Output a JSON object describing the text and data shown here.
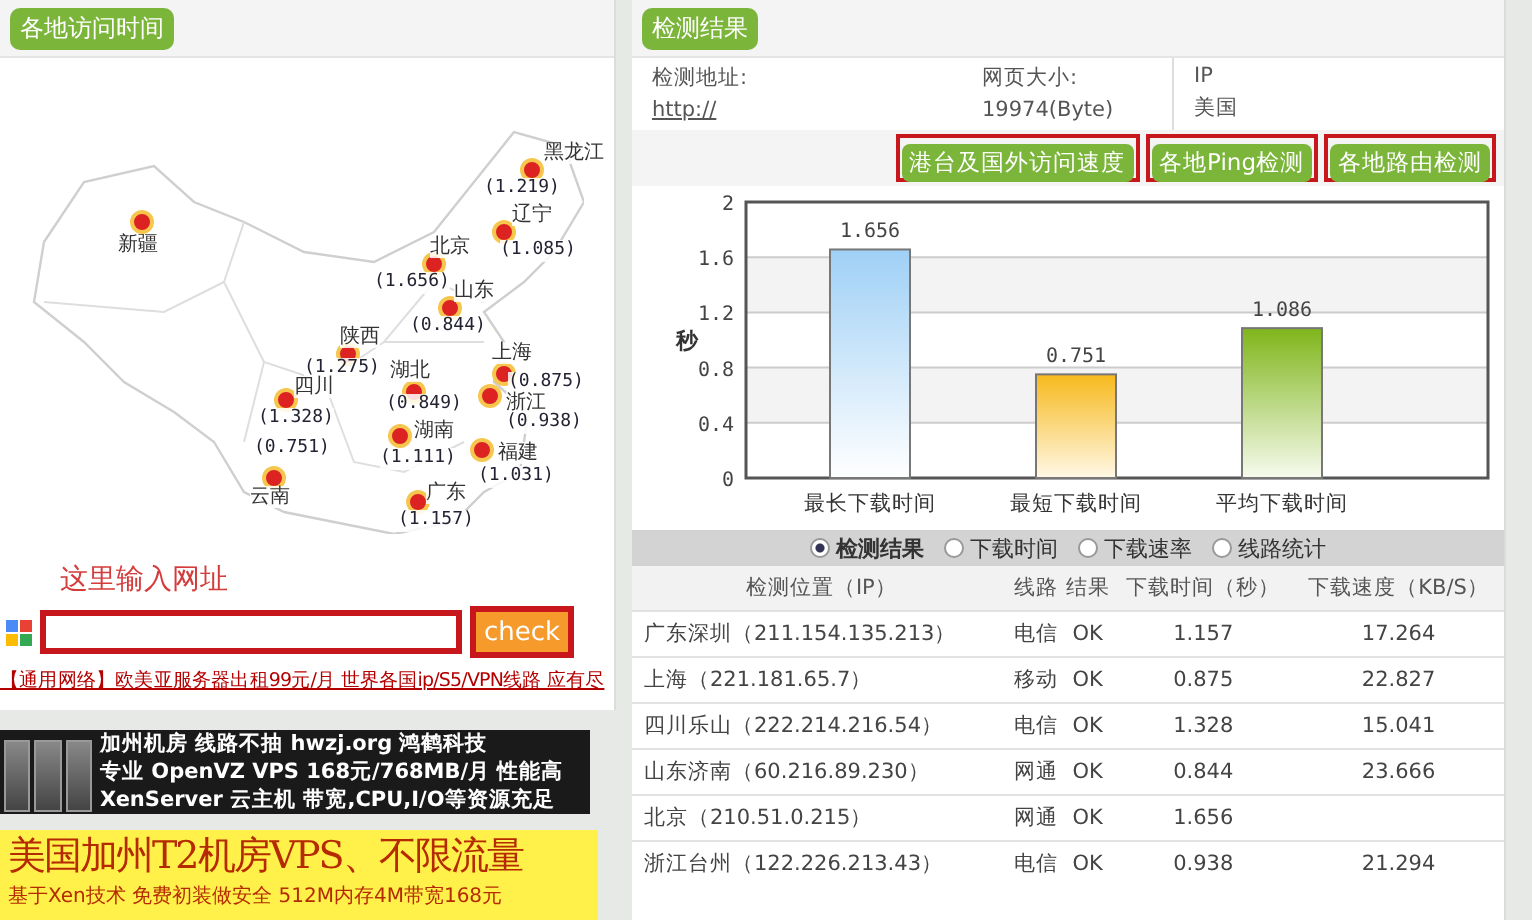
{
  "left_panel": {
    "title": "各地访问时间",
    "map_markers": [
      {
        "region": "黑龙江",
        "value": "(1.219)"
      },
      {
        "region": "新疆"
      },
      {
        "region": "辽宁",
        "value": "(1.085)"
      },
      {
        "region": "北京",
        "value": "(1.656)"
      },
      {
        "region": "山东",
        "value": "(0.844)"
      },
      {
        "region": "陕西",
        "value": "(1.275)"
      },
      {
        "region": "四川",
        "value": "(1.328)"
      },
      {
        "region": "湖北",
        "value": "(0.849)"
      },
      {
        "region": "上海",
        "value": "(0.875)"
      },
      {
        "region": "浙江",
        "value": "(0.938)"
      },
      {
        "region": "云南",
        "value": "(0.751)"
      },
      {
        "region": "湖南",
        "value": "(1.111)"
      },
      {
        "region": "福建",
        "value": "(1.031)"
      },
      {
        "region": "广东",
        "value": "(1.157)"
      }
    ],
    "hint": "这里输入网址",
    "check_button": "check",
    "promo_link": "【通用网络】欧美亚服务器出租99元/月 世界各国ip/S5/VPN线路 应有尽",
    "ads": [
      {
        "kind": "dark",
        "lines": [
          "加州机房 线路不抽  hwzj.org   鸿鹤科技",
          "专业 OpenVZ VPS 168元/768MB/月 性能高",
          "XenServer 云主机 带宽,CPU,I/O等资源充足"
        ]
      },
      {
        "kind": "yellow",
        "lines": [
          "美国加州T2机房VPS、不限流量",
          "基于Xen技术 免费初装做安全 512M内存4M带宽168元"
        ]
      }
    ]
  },
  "right_panel": {
    "title": "检测结果",
    "info": [
      {
        "label": "检测地址:",
        "value": "http://",
        "kind": "link"
      },
      {
        "label": "网页大小:",
        "value": "19974(Byte)",
        "kind": "text"
      },
      {
        "label": "IP",
        "value": "美国",
        "kind": "text"
      }
    ],
    "buttons": [
      "港台及国外访问速度",
      "各地Ping检测",
      "各地路由检测"
    ],
    "chart_data": {
      "type": "bar",
      "ylabel": "秒",
      "categories": [
        "最长下载时间",
        "最短下载时间",
        "平均下载时间"
      ],
      "values": [
        1.656,
        0.751,
        1.086
      ],
      "ylim": [
        0,
        2
      ],
      "yticks": [
        0,
        0.4,
        0.8,
        1.2,
        1.6,
        2
      ],
      "grid": true,
      "data_labels": true
    },
    "view_options": [
      {
        "label": "检测结果",
        "selected": true
      },
      {
        "label": "下载时间",
        "selected": false
      },
      {
        "label": "下载速率",
        "selected": false
      },
      {
        "label": "线路统计",
        "selected": false
      }
    ],
    "table": {
      "columns": [
        "检测位置（IP）",
        "线路",
        "结果",
        "下载时间（秒）",
        "下载速度（KB/S）"
      ],
      "rows": [
        [
          "广东深圳（211.154.135.213）",
          "电信",
          "OK",
          "1.157",
          "17.264"
        ],
        [
          "上海（221.181.65.7）",
          "移动",
          "OK",
          "0.875",
          "22.827"
        ],
        [
          "四川乐山（222.214.216.54）",
          "电信",
          "OK",
          "1.328",
          "15.041"
        ],
        [
          "山东济南（60.216.89.230）",
          "网通",
          "OK",
          "0.844",
          "23.666"
        ],
        [
          "北京（210.51.0.215）",
          "网通",
          "OK",
          "1.656",
          ""
        ],
        [
          "浙江台州（122.226.213.43）",
          "电信",
          "OK",
          "0.938",
          "21.294"
        ]
      ]
    }
  }
}
